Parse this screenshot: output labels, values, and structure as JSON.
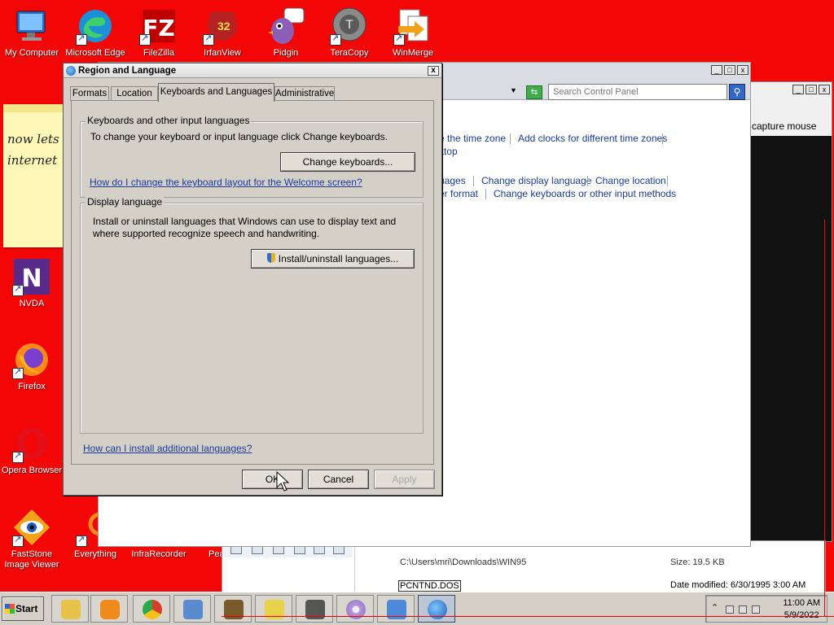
{
  "desktop": {
    "icons": [
      {
        "label": "My Computer",
        "icon": "computer-icon"
      },
      {
        "label": "Microsoft Edge",
        "icon": "edge-icon"
      },
      {
        "label": "FileZilla",
        "icon": "filezilla-icon"
      },
      {
        "label": "IrfanView",
        "icon": "irfanview-icon"
      },
      {
        "label": "Pidgin",
        "icon": "pidgin-icon"
      },
      {
        "label": "TeraCopy",
        "icon": "teracopy-icon"
      },
      {
        "label": "WinMerge",
        "icon": "winmerge-icon"
      },
      {
        "label": "NVDA",
        "icon": "nvda-icon"
      },
      {
        "label": "Firefox",
        "icon": "firefox-icon"
      },
      {
        "label": "Opera Browser",
        "icon": "opera-icon"
      },
      {
        "label": "FastStone Image Viewer",
        "icon": "faststone-icon"
      },
      {
        "label": "Everything",
        "icon": "everything-icon"
      },
      {
        "label": "InfraRecorder",
        "icon": "infrarecorder-icon"
      },
      {
        "label": "Pea",
        "icon": "peazip-icon"
      }
    ],
    "irfanview_badge": "32",
    "sticky_note": {
      "line1": "now lets",
      "line2": "internet"
    }
  },
  "control_panel": {
    "search_placeholder": "Search Control Panel",
    "links": {
      "time_zone": "e the time zone",
      "add_clocks": "Add clocks for different time zones",
      "ktop": "ktop",
      "uages": "uages",
      "change_display_language": "Change display language",
      "change_location": "Change location",
      "er_format": "er format",
      "change_keyboards_methods": "Change keyboards or other input methods"
    }
  },
  "background_window": {
    "caption": "capture mouse"
  },
  "explorer": {
    "path": "C:\\Users\\mri\\Downloads\\WIN95",
    "size": "Size: 19.5 KB",
    "file_name": "PCNTND.DOS",
    "date_modified": "Date modified: 6/30/1995 3:00 AM"
  },
  "dialog": {
    "title": "Region and Language",
    "close": "x",
    "tabs": [
      "Formats",
      "Location",
      "Keyboards and Languages",
      "Administrative"
    ],
    "active_tab": "Keyboards and Languages",
    "keyboards_group": {
      "title": "Keyboards and other input languages",
      "description": "To change your keyboard or input language click Change keyboards.",
      "button": "Change keyboards...",
      "help_link": "How do I change the keyboard layout for the Welcome screen?"
    },
    "display_group": {
      "title": "Display language",
      "description_line1": "Install or uninstall languages that Windows can use to display text and",
      "description_line2": "where supported recognize speech and handwriting.",
      "button": "Install/uninstall languages..."
    },
    "bottom_link": "How can I install additional languages?",
    "buttons": {
      "ok": "OK",
      "cancel": "Cancel",
      "apply": "Apply"
    }
  },
  "taskbar": {
    "start": "Start",
    "clock_time": "11:00 AM",
    "clock_date": "5/9/2022"
  },
  "colors": {
    "desktop": "#f20606",
    "link": "#1a3b9b",
    "dialog": "#d4d0c8"
  }
}
